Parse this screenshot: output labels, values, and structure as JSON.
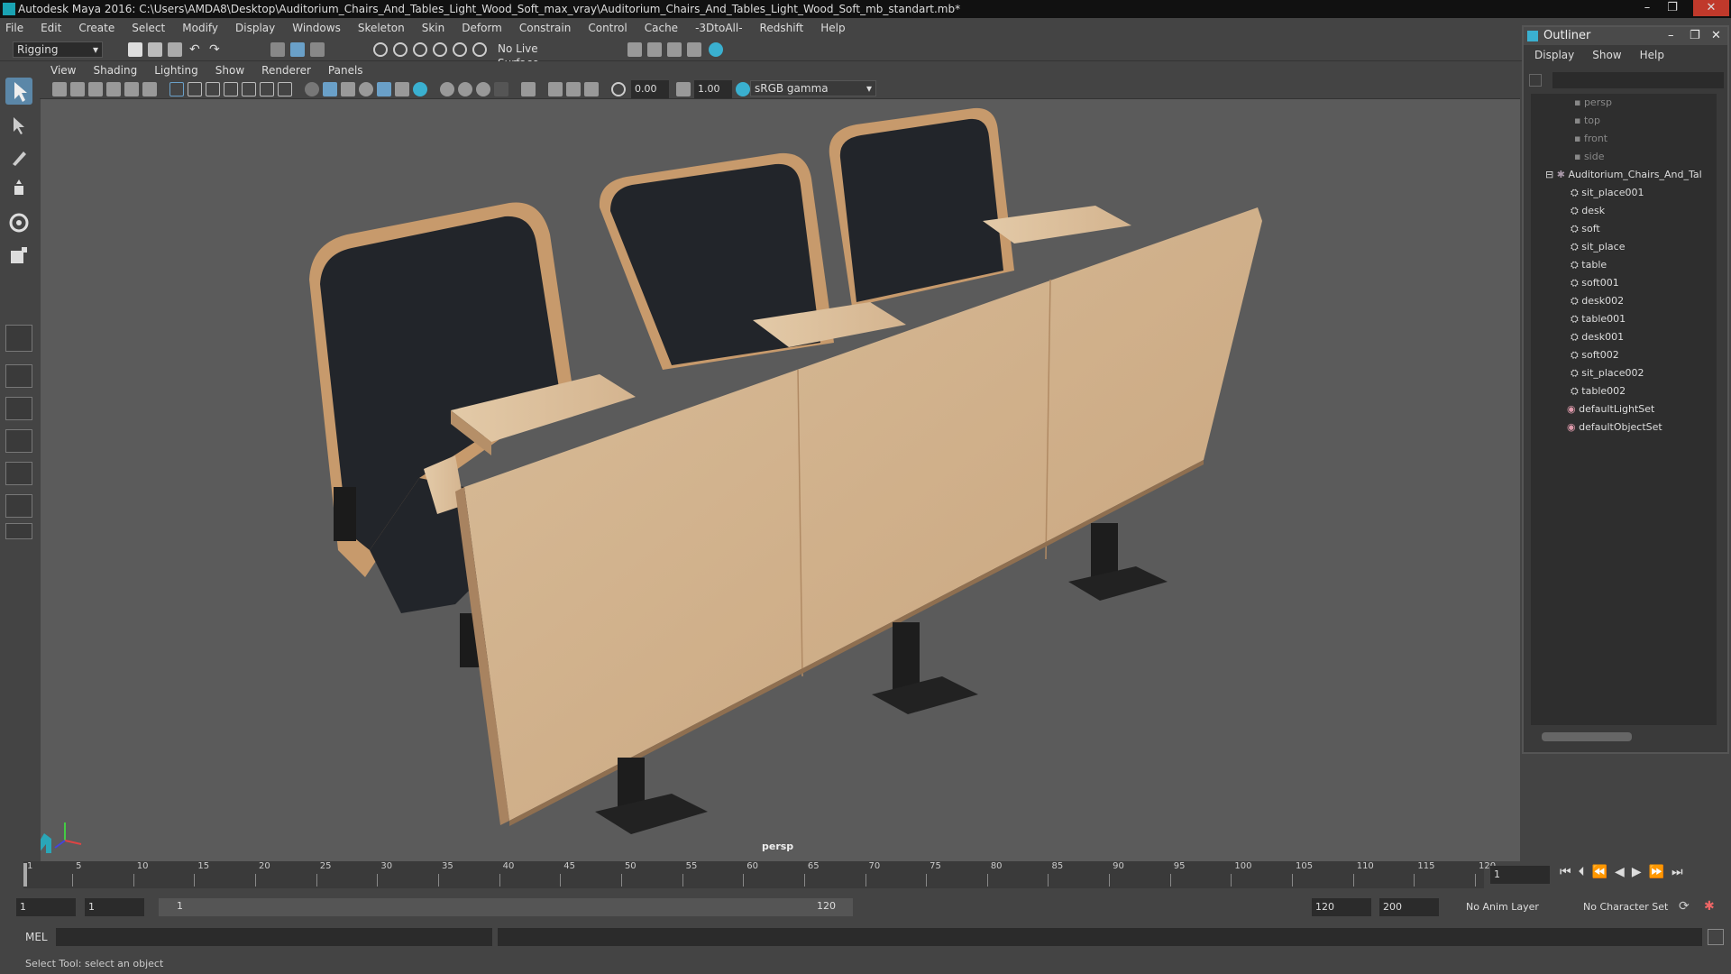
{
  "window": {
    "title": "Autodesk Maya 2016: C:\\Users\\AMDA8\\Desktop\\Auditorium_Chairs_And_Tables_Light_Wood_Soft_max_vray\\Auditorium_Chairs_And_Tables_Light_Wood_Soft_mb_standart.mb*"
  },
  "menubar": [
    "File",
    "Edit",
    "Create",
    "Select",
    "Modify",
    "Display",
    "Windows",
    "Skeleton",
    "Skin",
    "Deform",
    "Constrain",
    "Control",
    "Cache",
    "-3DtoAll-",
    "Redshift",
    "Help"
  ],
  "shelf": {
    "mode": "Rigging",
    "live_surface": "No Live Surface"
  },
  "viewport_menu": [
    "View",
    "Shading",
    "Lighting",
    "Show",
    "Renderer",
    "Panels"
  ],
  "viewport_toolbar": {
    "exposure": "0.00",
    "gamma": "1.00",
    "color_space": "sRGB gamma"
  },
  "viewport": {
    "camera_label": "persp"
  },
  "outliner": {
    "title": "Outliner",
    "menu": [
      "Display",
      "Show",
      "Help"
    ],
    "cameras": [
      "persp",
      "top",
      "front",
      "side"
    ],
    "group": "Auditorium_Chairs_And_Tal",
    "children": [
      "sit_place001",
      "desk",
      "soft",
      "sit_place",
      "table",
      "soft001",
      "desk002",
      "table001",
      "desk001",
      "soft002",
      "sit_place002",
      "table002"
    ],
    "sets": [
      "defaultLightSet",
      "defaultObjectSet"
    ]
  },
  "timeline": {
    "ticks": [
      "1",
      "5",
      "10",
      "15",
      "20",
      "25",
      "30",
      "35",
      "40",
      "45",
      "50",
      "55",
      "60",
      "65",
      "70",
      "75",
      "80",
      "85",
      "90",
      "95",
      "100",
      "105",
      "110",
      "115",
      "120"
    ],
    "current_frame": "1"
  },
  "range": {
    "start": "1",
    "playback_start": "1",
    "slider_start": "1",
    "slider_end": "120",
    "playback_end": "120",
    "end": "200",
    "anim_layer": "No Anim Layer",
    "character_set": "No Character Set"
  },
  "cmdline": {
    "label": "MEL"
  },
  "helpline": {
    "text": "Select Tool: select an object"
  }
}
